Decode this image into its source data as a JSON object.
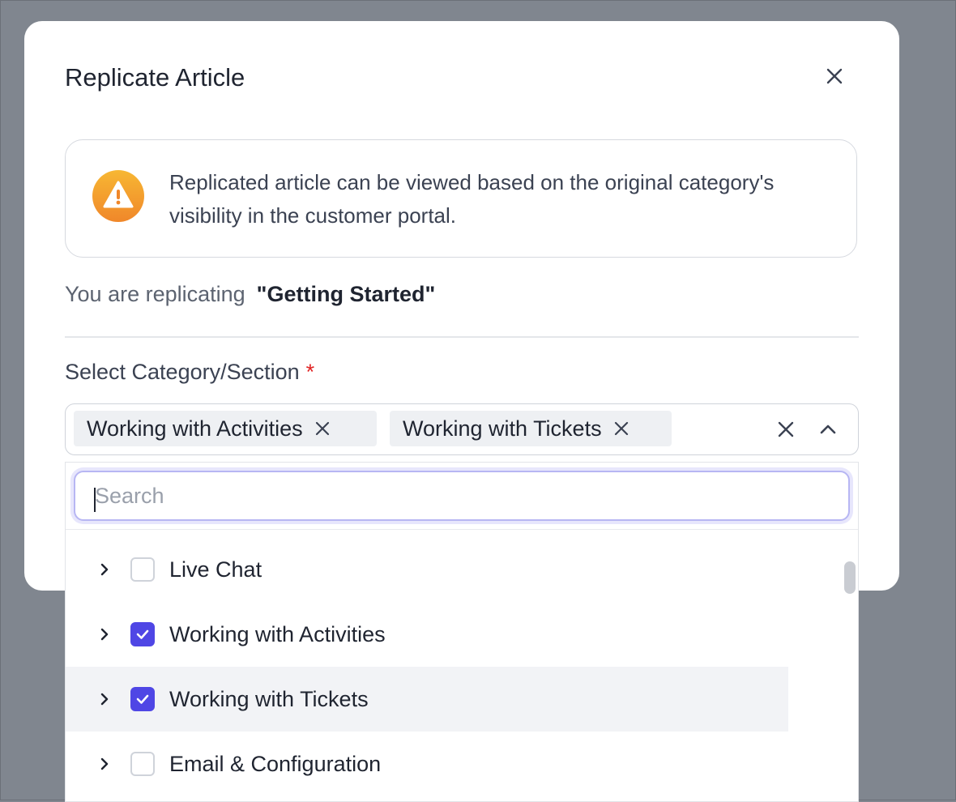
{
  "modal": {
    "title": "Replicate Article",
    "info_text": "Replicated article can be viewed based on the original category's visibility in the customer portal.",
    "replicating_prefix": "You are replicating",
    "replicating_name": "\"Getting Started\"",
    "field_label": "Select Category/Section",
    "required_mark": "*"
  },
  "select": {
    "chips": [
      {
        "label": "Working with Activities"
      },
      {
        "label": "Working with Tickets"
      }
    ]
  },
  "dropdown": {
    "search_placeholder": "Search",
    "items": [
      {
        "label": "Live Chat",
        "checked": false
      },
      {
        "label": "Working with Activities",
        "checked": true
      },
      {
        "label": "Working with Tickets",
        "checked": true,
        "highlighted": true
      },
      {
        "label": "Email & Configuration",
        "checked": false
      }
    ]
  },
  "icons": {
    "close": "close-icon",
    "warning": "warning-icon",
    "chip_remove": "x-icon",
    "clear_all": "clear-icon",
    "collapse": "chevron-up-icon",
    "expand": "chevron-right-icon",
    "check": "check-icon"
  },
  "colors": {
    "accent": "#4f46e5",
    "warning_start": "#f7b733",
    "warning_end": "#f0872a",
    "required": "#e02424",
    "overlay": "#80868f"
  }
}
